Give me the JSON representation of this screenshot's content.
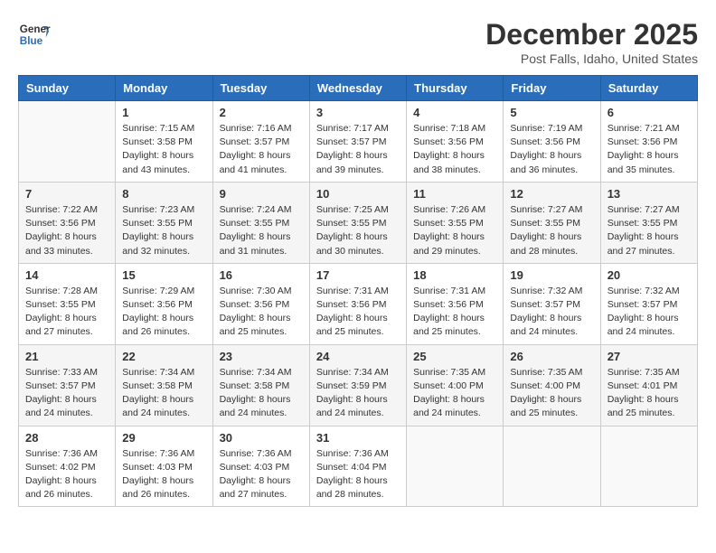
{
  "header": {
    "logo_line1": "General",
    "logo_line2": "Blue",
    "month": "December 2025",
    "location": "Post Falls, Idaho, United States"
  },
  "weekdays": [
    "Sunday",
    "Monday",
    "Tuesday",
    "Wednesday",
    "Thursday",
    "Friday",
    "Saturday"
  ],
  "weeks": [
    [
      {
        "day": "",
        "info": ""
      },
      {
        "day": "1",
        "info": "Sunrise: 7:15 AM\nSunset: 3:58 PM\nDaylight: 8 hours\nand 43 minutes."
      },
      {
        "day": "2",
        "info": "Sunrise: 7:16 AM\nSunset: 3:57 PM\nDaylight: 8 hours\nand 41 minutes."
      },
      {
        "day": "3",
        "info": "Sunrise: 7:17 AM\nSunset: 3:57 PM\nDaylight: 8 hours\nand 39 minutes."
      },
      {
        "day": "4",
        "info": "Sunrise: 7:18 AM\nSunset: 3:56 PM\nDaylight: 8 hours\nand 38 minutes."
      },
      {
        "day": "5",
        "info": "Sunrise: 7:19 AM\nSunset: 3:56 PM\nDaylight: 8 hours\nand 36 minutes."
      },
      {
        "day": "6",
        "info": "Sunrise: 7:21 AM\nSunset: 3:56 PM\nDaylight: 8 hours\nand 35 minutes."
      }
    ],
    [
      {
        "day": "7",
        "info": "Sunrise: 7:22 AM\nSunset: 3:56 PM\nDaylight: 8 hours\nand 33 minutes."
      },
      {
        "day": "8",
        "info": "Sunrise: 7:23 AM\nSunset: 3:55 PM\nDaylight: 8 hours\nand 32 minutes."
      },
      {
        "day": "9",
        "info": "Sunrise: 7:24 AM\nSunset: 3:55 PM\nDaylight: 8 hours\nand 31 minutes."
      },
      {
        "day": "10",
        "info": "Sunrise: 7:25 AM\nSunset: 3:55 PM\nDaylight: 8 hours\nand 30 minutes."
      },
      {
        "day": "11",
        "info": "Sunrise: 7:26 AM\nSunset: 3:55 PM\nDaylight: 8 hours\nand 29 minutes."
      },
      {
        "day": "12",
        "info": "Sunrise: 7:27 AM\nSunset: 3:55 PM\nDaylight: 8 hours\nand 28 minutes."
      },
      {
        "day": "13",
        "info": "Sunrise: 7:27 AM\nSunset: 3:55 PM\nDaylight: 8 hours\nand 27 minutes."
      }
    ],
    [
      {
        "day": "14",
        "info": "Sunrise: 7:28 AM\nSunset: 3:55 PM\nDaylight: 8 hours\nand 27 minutes."
      },
      {
        "day": "15",
        "info": "Sunrise: 7:29 AM\nSunset: 3:56 PM\nDaylight: 8 hours\nand 26 minutes."
      },
      {
        "day": "16",
        "info": "Sunrise: 7:30 AM\nSunset: 3:56 PM\nDaylight: 8 hours\nand 25 minutes."
      },
      {
        "day": "17",
        "info": "Sunrise: 7:31 AM\nSunset: 3:56 PM\nDaylight: 8 hours\nand 25 minutes."
      },
      {
        "day": "18",
        "info": "Sunrise: 7:31 AM\nSunset: 3:56 PM\nDaylight: 8 hours\nand 25 minutes."
      },
      {
        "day": "19",
        "info": "Sunrise: 7:32 AM\nSunset: 3:57 PM\nDaylight: 8 hours\nand 24 minutes."
      },
      {
        "day": "20",
        "info": "Sunrise: 7:32 AM\nSunset: 3:57 PM\nDaylight: 8 hours\nand 24 minutes."
      }
    ],
    [
      {
        "day": "21",
        "info": "Sunrise: 7:33 AM\nSunset: 3:57 PM\nDaylight: 8 hours\nand 24 minutes."
      },
      {
        "day": "22",
        "info": "Sunrise: 7:34 AM\nSunset: 3:58 PM\nDaylight: 8 hours\nand 24 minutes."
      },
      {
        "day": "23",
        "info": "Sunrise: 7:34 AM\nSunset: 3:58 PM\nDaylight: 8 hours\nand 24 minutes."
      },
      {
        "day": "24",
        "info": "Sunrise: 7:34 AM\nSunset: 3:59 PM\nDaylight: 8 hours\nand 24 minutes."
      },
      {
        "day": "25",
        "info": "Sunrise: 7:35 AM\nSunset: 4:00 PM\nDaylight: 8 hours\nand 24 minutes."
      },
      {
        "day": "26",
        "info": "Sunrise: 7:35 AM\nSunset: 4:00 PM\nDaylight: 8 hours\nand 25 minutes."
      },
      {
        "day": "27",
        "info": "Sunrise: 7:35 AM\nSunset: 4:01 PM\nDaylight: 8 hours\nand 25 minutes."
      }
    ],
    [
      {
        "day": "28",
        "info": "Sunrise: 7:36 AM\nSunset: 4:02 PM\nDaylight: 8 hours\nand 26 minutes."
      },
      {
        "day": "29",
        "info": "Sunrise: 7:36 AM\nSunset: 4:03 PM\nDaylight: 8 hours\nand 26 minutes."
      },
      {
        "day": "30",
        "info": "Sunrise: 7:36 AM\nSunset: 4:03 PM\nDaylight: 8 hours\nand 27 minutes."
      },
      {
        "day": "31",
        "info": "Sunrise: 7:36 AM\nSunset: 4:04 PM\nDaylight: 8 hours\nand 28 minutes."
      },
      {
        "day": "",
        "info": ""
      },
      {
        "day": "",
        "info": ""
      },
      {
        "day": "",
        "info": ""
      }
    ]
  ]
}
